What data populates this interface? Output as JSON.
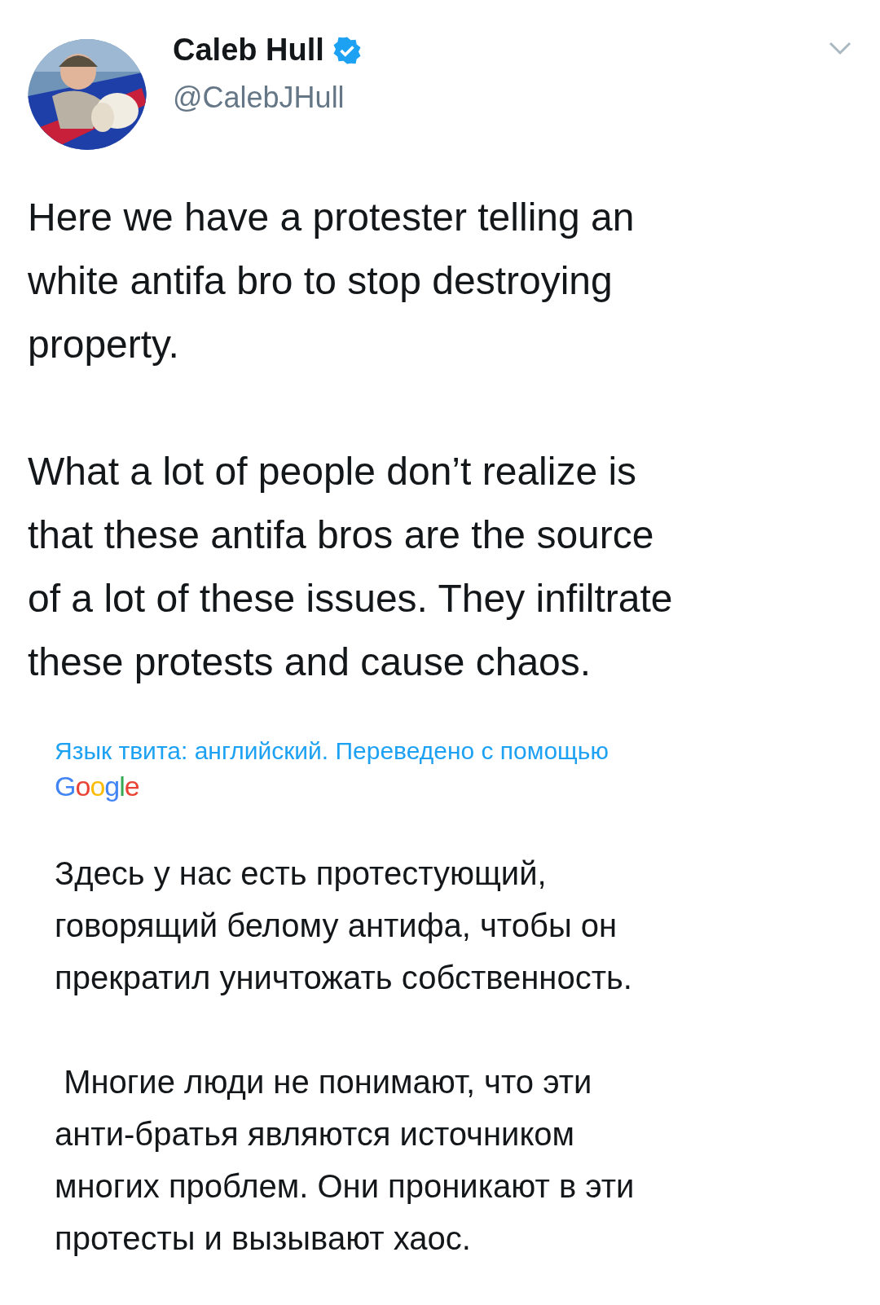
{
  "author": {
    "name": "Caleb Hull",
    "verified": true,
    "handle": "@CalebJHull"
  },
  "tweet": {
    "text": "Here we have a protester telling an\nwhite antifa bro to stop destroying\nproperty.\n\nWhat a lot of people don’t realize is\nthat these antifa bros are the source\nof a lot of these issues. They infiltrate\nthese protests and cause chaos."
  },
  "translation": {
    "label": "Язык твита: английский. Переведено с помощью",
    "provider": "Google",
    "text": "Здесь у нас есть протестующий,\nговорящий белому антифа, чтобы он\nпрекратил уничтожать собственность.\n\n Многие люди не понимают, что эти\nанти-братья являются источником\nмногих проблем. Они проникают в эти\nпротесты и вызывают хаос."
  }
}
